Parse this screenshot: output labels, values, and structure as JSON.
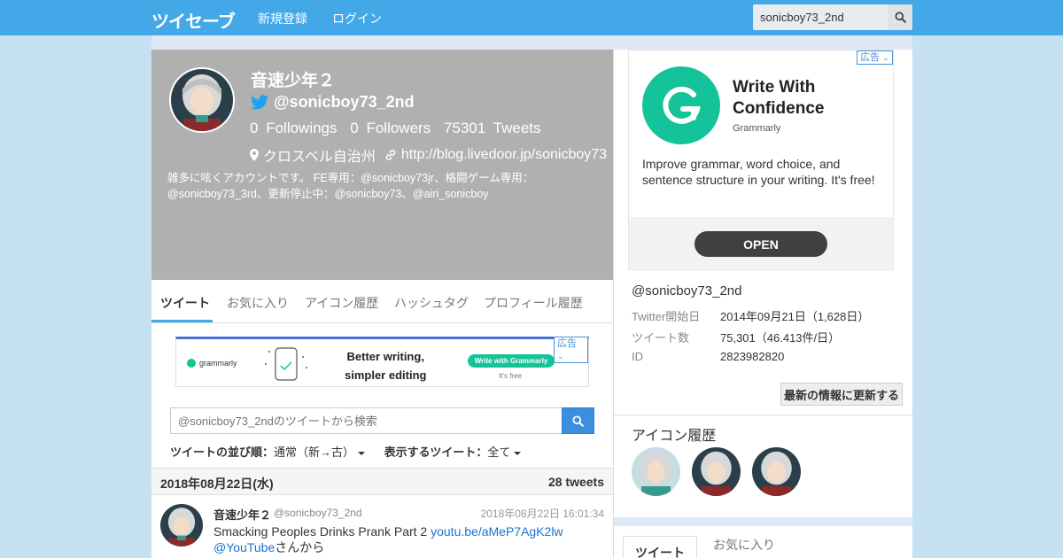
{
  "header": {
    "logo": "ツイセーブ",
    "nav": [
      "新規登録",
      "ログイン"
    ],
    "search_value": "sonicboy73_2nd"
  },
  "profile": {
    "name": "音速少年２",
    "handle": "@sonicboy73_2nd",
    "followings_count": "0",
    "followings_label": "Followings",
    "followers_count": "0",
    "followers_label": "Followers",
    "tweets_count": "75301",
    "tweets_label": "Tweets",
    "location": "クロスベル自治州",
    "url": "http://blog.livedoor.jp/sonicboy73",
    "bio": "雑多に呟くアカウントです。 FE専用：@sonicboy73jr、格闘ゲーム専用：@sonicboy73_3rd、更新停止中：@sonicboy73、@airi_sonicboy"
  },
  "tabs": [
    "ツイート",
    "お気に入り",
    "アイコン履歴",
    "ハッシュタグ",
    "プロフィール履歴"
  ],
  "ad_banner": {
    "tag": "広告",
    "brand": "grammarly",
    "headline_1": "Better writing,",
    "headline_2": "simpler editing",
    "cta": "Write with Grammarly",
    "sub": "It's free"
  },
  "tweet_search": {
    "placeholder": "@sonicboy73_2ndのツイートから検索"
  },
  "sort": {
    "order_label": "ツイートの並び順：",
    "order_value": "通常（新→古）",
    "show_label": "表示するツイート：",
    "show_value": "全て"
  },
  "day": {
    "date": "2018年08月22日(水)",
    "count": "28 tweets"
  },
  "tweet": {
    "name": "音速少年２",
    "handle": "@sonicboy73_2nd",
    "time": "2018年08月22日 16:01:34",
    "text_1": "Smacking Peoples Drinks Prank Part 2 ",
    "link_1": "youtu.be/aMeP7AgK2lw",
    "link_2": "@YouTube",
    "text_2": "さんから"
  },
  "side_ad": {
    "tag": "広告",
    "title_1": "Write With",
    "title_2": "Confidence",
    "brand": "Grammarly",
    "desc": "Improve grammar, word choice, and sentence structure in your writing. It's free!",
    "cta": "OPEN"
  },
  "info": {
    "handle": "@sonicboy73_2nd",
    "rows": [
      {
        "k": "Twitter開始日",
        "v": "2014年09月21日（1,628日）"
      },
      {
        "k": "ツイート数",
        "v": "75,301（46.413件/日）"
      },
      {
        "k": "ID",
        "v": "2823982820"
      }
    ],
    "update_button": "最新の情報に更新する"
  },
  "icon_history": {
    "title": "アイコン履歴"
  },
  "right_tabs": [
    "ツイート",
    "お気に入り"
  ],
  "colors": {
    "topbar": "#43a8e8",
    "profile_bg": "#b0b0b0",
    "link": "#1a73c9",
    "grammarly": "#15c39a"
  }
}
